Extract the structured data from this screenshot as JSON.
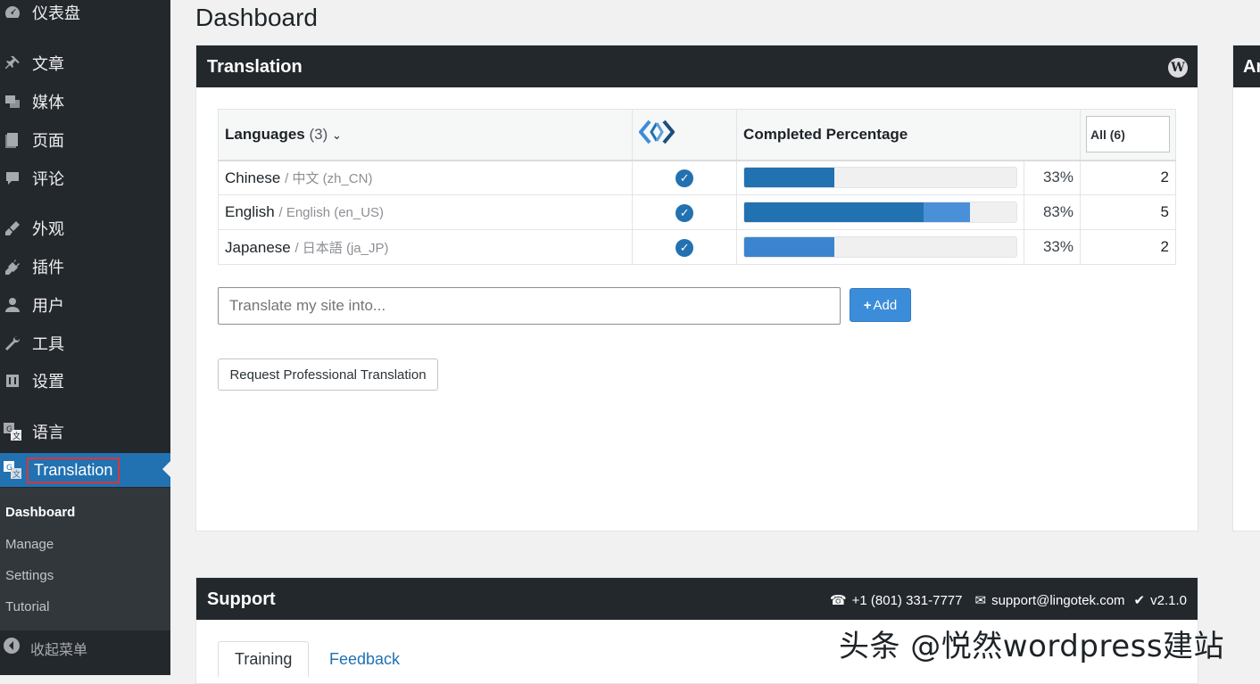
{
  "sidebar": {
    "items": [
      {
        "label": "仪表盘",
        "icon": "dashboard-icon",
        "top": 0
      },
      {
        "label": "文章",
        "icon": "pin-icon"
      },
      {
        "label": "媒体",
        "icon": "media-icon"
      },
      {
        "label": "页面",
        "icon": "pages-icon"
      },
      {
        "label": "评论",
        "icon": "comments-icon"
      },
      {
        "label": "外观",
        "icon": "appearance-icon"
      },
      {
        "label": "插件",
        "icon": "plugins-icon"
      },
      {
        "label": "用户",
        "icon": "users-icon"
      },
      {
        "label": "工具",
        "icon": "tools-icon"
      },
      {
        "label": "设置",
        "icon": "settings-icon"
      },
      {
        "label": "语言",
        "icon": "language-icon"
      },
      {
        "label": "Translation",
        "icon": "translation-icon"
      }
    ],
    "submenu": [
      "Dashboard",
      "Manage",
      "Settings",
      "Tutorial"
    ],
    "collapse_label": "收起菜单"
  },
  "page_title": "Dashboard",
  "translation_panel": {
    "title": "Translation",
    "table": {
      "lang_header": "Languages",
      "lang_count": "(3)",
      "completed_header": "Completed Percentage",
      "filter_label": "All (6)",
      "rows": [
        {
          "name": "Chinese",
          "native": "/ 中文 (zh_CN)",
          "percent_label": "33%",
          "percent": 33,
          "count": "2",
          "color": "#2271b1"
        },
        {
          "name": "English",
          "native": "/ English (en_US)",
          "percent_label": "83%",
          "percent": 83,
          "count": "5",
          "color": "#2271b1",
          "extra_color": "#4a90d9"
        },
        {
          "name": "Japanese",
          "native": "/ 日本語 (ja_JP)",
          "percent_label": "33%",
          "percent": 33,
          "count": "2",
          "color": "#3c84cf"
        }
      ]
    },
    "input_placeholder": "Translate my site into...",
    "add_label": "Add",
    "request_label": "Request Professional Translation"
  },
  "support_panel": {
    "title": "Support",
    "phone": "+1 (801) 331-7777",
    "email": "support@lingotek.com",
    "version": "v2.1.0",
    "tabs": [
      "Training",
      "Feedback"
    ]
  },
  "side_panel_partial_title": "Ar",
  "watermark": "头条 @悦然wordpress建站",
  "colors": {
    "accent": "#2271b1",
    "sidebar_bg": "#23282d",
    "header_bg": "#23282d"
  }
}
